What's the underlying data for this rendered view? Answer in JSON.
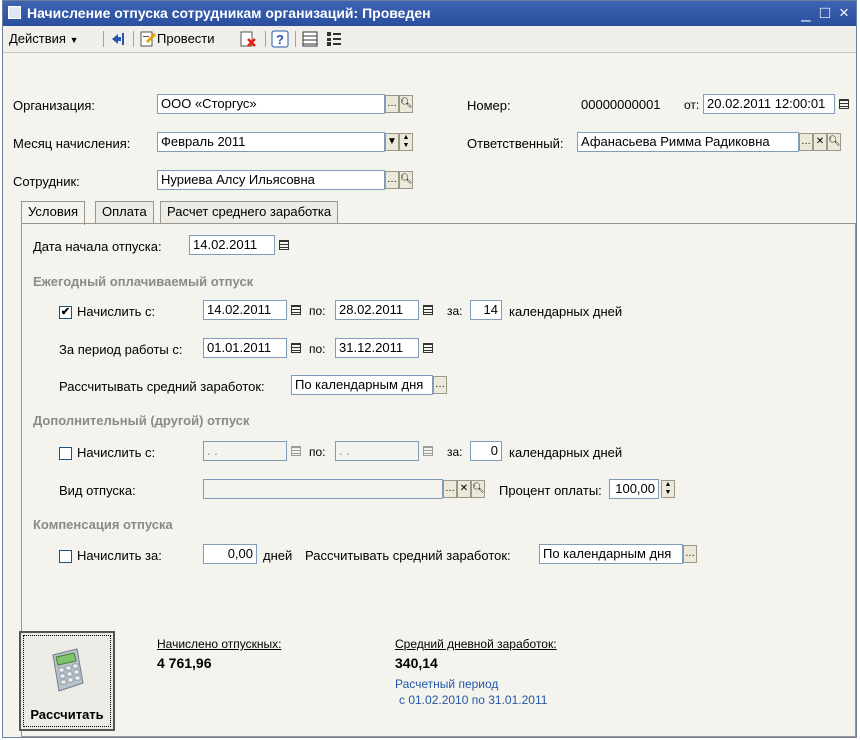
{
  "window": {
    "title": "Начисление отпуска сотрудникам организаций: Проведен",
    "minimize": "_",
    "maximize": "□",
    "close": "×"
  },
  "toolbar": {
    "actions_label": "Действия",
    "post_label": "Провести"
  },
  "header": {
    "organization_label": "Организация:",
    "organization_value": "ООО «Сторгус»",
    "month_label": "Месяц начисления:",
    "month_value": "Февраль 2011",
    "employee_label": "Сотрудник:",
    "employee_value": "Нуриева Алсу Ильясовна",
    "number_label": "Номер:",
    "number_value": "00000000001",
    "date_from_label": "от:",
    "date_value": "20.02.2011 12:00:01",
    "responsible_label": "Ответственный:",
    "responsible_value": "Афанасьева Римма Радиковна"
  },
  "tabs": [
    "Условия",
    "Оплата",
    "Расчет среднего заработка"
  ],
  "conditions": {
    "vacation_start_label": "Дата начала отпуска:",
    "vacation_start_value": "14.02.2011",
    "annual": {
      "section_title": "Ежегодный оплачиваемый отпуск",
      "accrue_label": "Начислить с:",
      "checked": true,
      "from": "14.02.2011",
      "to_label": "по:",
      "to": "28.02.2011",
      "for_label": "за:",
      "days": "14",
      "days_label": "календарных дней",
      "work_period_label": "За период работы с:",
      "work_from": "01.01.2011",
      "work_to_label": "по:",
      "work_to": "31.12.2011",
      "avg_calc_label": "Рассчитывать средний заработок:",
      "avg_calc_value": "По календарным дня"
    },
    "additional": {
      "section_title": "Дополнительный (другой) отпуск",
      "accrue_label": "Начислить с:",
      "checked": false,
      "from": " .  .",
      "to_label": "по:",
      "to": " .  .",
      "for_label": "за:",
      "days": "0",
      "days_label": "календарных дней",
      "type_label": "Вид отпуска:",
      "type_value": "",
      "percent_label": "Процент оплаты:",
      "percent_value": "100,00"
    },
    "compensation": {
      "section_title": "Компенсация отпуска",
      "accrue_label": "Начислить за:",
      "checked": false,
      "days_value": "0,00",
      "days_label": "дней",
      "avg_calc_label": "Рассчитывать средний заработок:",
      "avg_calc_value": "По календарным дня"
    }
  },
  "results": {
    "calculate_label": "Рассчитать",
    "accrued_label": "Начислено отпускных:",
    "accrued_value": "4 761,96",
    "avg_daily_label": "Средний дневной заработок:",
    "avg_daily_value": "340,14",
    "period_label": "Расчетный период",
    "period_value": "с 01.02.2010 по 31.01.2011"
  }
}
